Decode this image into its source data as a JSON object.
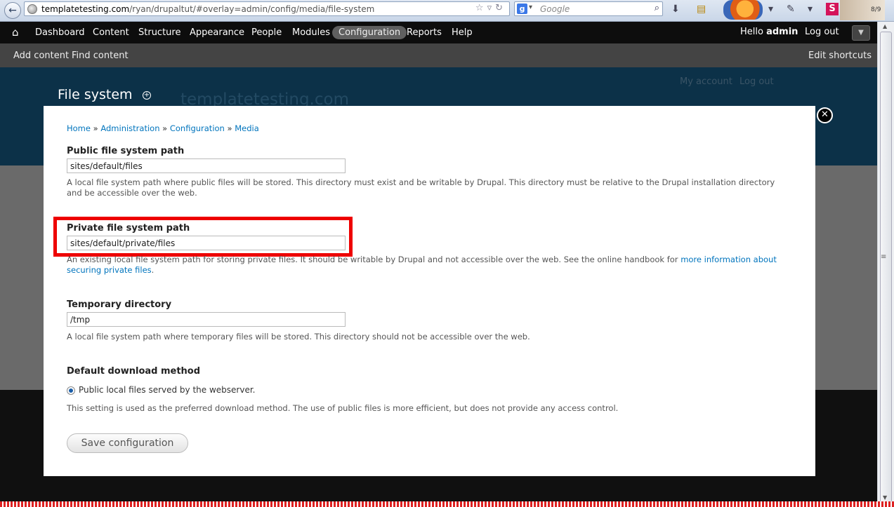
{
  "browser": {
    "url_domain": "templatetesting.com",
    "url_path": "/ryan/drupaltut/#overlay=admin/config/media/file-system",
    "search_engine_letter": "g",
    "search_placeholder": "Google",
    "extension_badge": "S",
    "extension_count": "8/9"
  },
  "toolbar": {
    "items": [
      "Dashboard",
      "Content",
      "Structure",
      "Appearance",
      "People",
      "Modules",
      "Configuration",
      "Reports",
      "Help"
    ],
    "active_index": 6,
    "hello_prefix": "Hello ",
    "username": "admin",
    "logout": "Log out"
  },
  "shortcuts": {
    "add_content": "Add content",
    "find_content": "Find content",
    "edit_shortcuts": "Edit shortcuts"
  },
  "background_page": {
    "my_account": "My account",
    "log_out": "Log out",
    "site_name": "templatetesting.com"
  },
  "overlay": {
    "title": "File system",
    "breadcrumb": [
      "Home",
      "Administration",
      "Configuration",
      "Media"
    ],
    "breadcrumb_separator": " » "
  },
  "form": {
    "public": {
      "label": "Public file system path",
      "value": "sites/default/files",
      "description": "A local file system path where public files will be stored. This directory must exist and be writable by Drupal. This directory must be relative to the Drupal installation directory and be accessible over the web."
    },
    "private": {
      "label": "Private file system path",
      "value": "sites/default/private/files",
      "description": "An existing local file system path for storing private files. It should be writable by Drupal and not accessible over the web. See the online handbook for ",
      "link_text": "more information about securing private files",
      "description_end": "."
    },
    "temporary": {
      "label": "Temporary directory",
      "value": "/tmp",
      "description": "A local file system path where temporary files will be stored. This directory should not be accessible over the web."
    },
    "download": {
      "label": "Default download method",
      "option": "Public local files served by the webserver.",
      "selected": true,
      "description": "This setting is used as the preferred download method. The use of public files is more efficient, but does not provide any access control."
    },
    "save_label": "Save configuration"
  },
  "colors": {
    "highlight_box": "#ee0000",
    "link": "#0074bd",
    "toolbar_bg": "#0d0d0d",
    "header_bg": "#0e3a55"
  }
}
